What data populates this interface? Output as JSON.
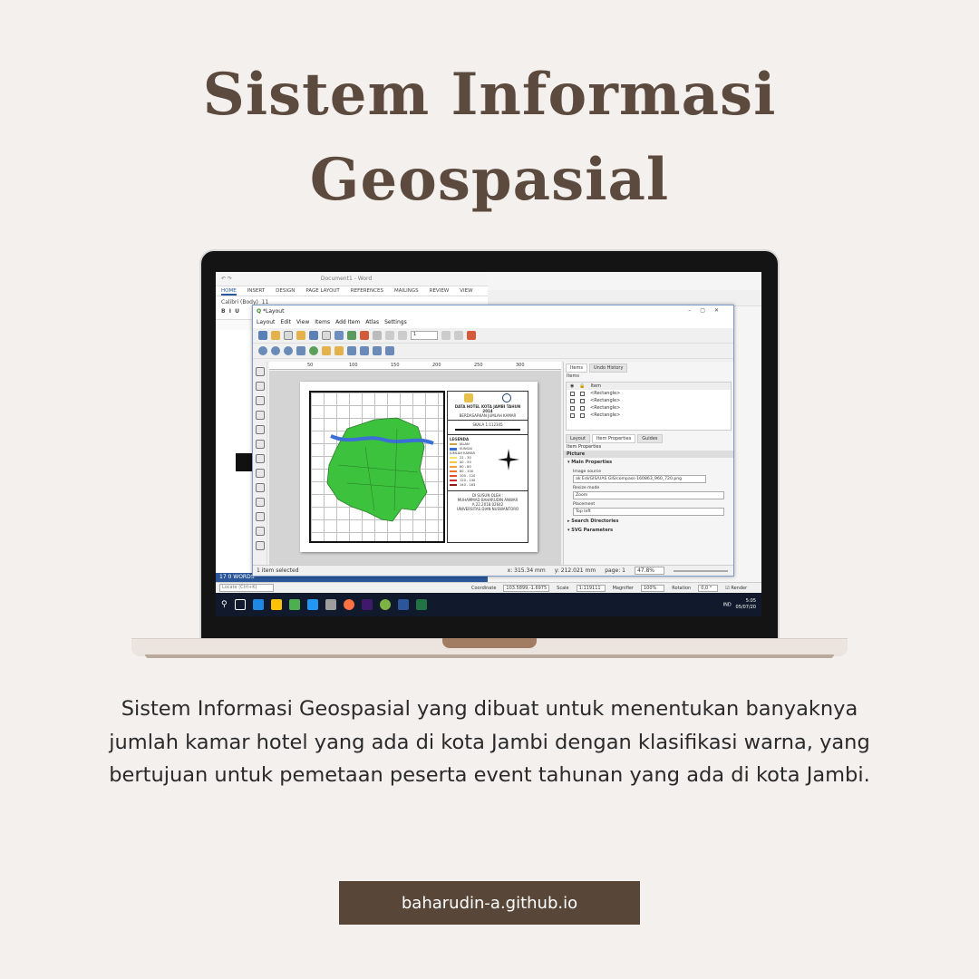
{
  "title": {
    "line1": "Sistem Informasi",
    "line2": "Geospasial"
  },
  "description": "Sistem Informasi Geospasial yang dibuat untuk menentukan banyaknya jumlah kamar hotel yang ada di kota Jambi dengan klasifikasi warna, yang bertujuan untuk pemetaan peserta event tahunan yang ada di kota Jambi.",
  "link_button": "baharudin-a.github.io",
  "screenshot": {
    "word": {
      "title": "Document1 - Word",
      "tabs": [
        "HOME",
        "INSERT",
        "DESIGN",
        "PAGE LAYOUT",
        "REFERENCES",
        "MAILINGS",
        "REVIEW",
        "VIEW"
      ],
      "font": "Calibri (Body)",
      "font_size": "11",
      "status": "17   0 WORDS"
    },
    "layout": {
      "title": "*Layout",
      "menu": [
        "Layout",
        "Edit",
        "View",
        "Items",
        "Add Item",
        "Atlas",
        "Settings"
      ],
      "page_num": "1",
      "ruler": [
        "50",
        "100",
        "150",
        "200",
        "250",
        "300"
      ],
      "status_selected": "1 item selected",
      "status_x": "x: 315.34 mm",
      "status_y": "y: 212.021 mm",
      "status_page": "page: 1",
      "zoom": "47.8%",
      "map_legend": {
        "title_line1": "DATA HOTEL KOTA JAMBI TAHUN 2014",
        "title_line2": "BERDASARKAN JUMLAH KAMAR",
        "scale": "SKALA  1:112345",
        "legend_title": "LEGENDA",
        "jalan": "JALAN",
        "sungai": "SUNGAI",
        "jumlah_kamar": "JUMLAH KAMAR",
        "classes": [
          "22 - 30",
          "40 - 50",
          "60 - 80",
          "80 - 100",
          "100 - 120",
          "120 - 140",
          "140 - 163"
        ],
        "author_1": "DI SUSUN OLEH :",
        "author_2": "MUHAMMAD BAHARUDIN ANWAR",
        "author_3": "A.22.2018.02642",
        "author_4": "UNIVERSITAS DIAN NUSWANTORO"
      },
      "panel": {
        "tabs": [
          "Items",
          "Undo History"
        ],
        "items_label": "Items",
        "item_col": "Item",
        "items": [
          "<Rectangle>",
          "<Rectangle>",
          "<Rectangle>",
          "<Rectangle>"
        ],
        "tabs2": [
          "Layout",
          "Item Properties",
          "Guides"
        ],
        "item_properties": "Item Properties",
        "picture": "Picture",
        "main_properties": "Main Properties",
        "image_source_label": "Image source",
        "image_source": "ak Edi/GIS/UAS GIS/compass-160863_960_720.png",
        "resize_label": "Resize mode",
        "resize_value": "Zoom",
        "placement_label": "Placement",
        "placement_value": "Top left",
        "search_dirs": "Search Directories",
        "svg_params": "SVG Parameters"
      }
    },
    "qgis_status": {
      "locate": "Locate (Ctrl+K)",
      "coordinate_label": "Coordinate",
      "coordinate": "103.5899,-1.6975",
      "scale_label": "Scale",
      "scale": "1:119111",
      "magnifier_label": "Magnifier",
      "magnifier": "100%",
      "rotation_label": "Rotation",
      "rotation": "0,0 °",
      "render": "Render"
    },
    "taskbar": {
      "lang": "IND",
      "time": "5:05",
      "date": "05/07/20"
    }
  },
  "colors": {
    "title": "#5b4a3d",
    "button_bg": "#584738",
    "background": "#f3f0ed",
    "map_green": "#3cc23c",
    "river_blue": "#3b6fd6"
  }
}
